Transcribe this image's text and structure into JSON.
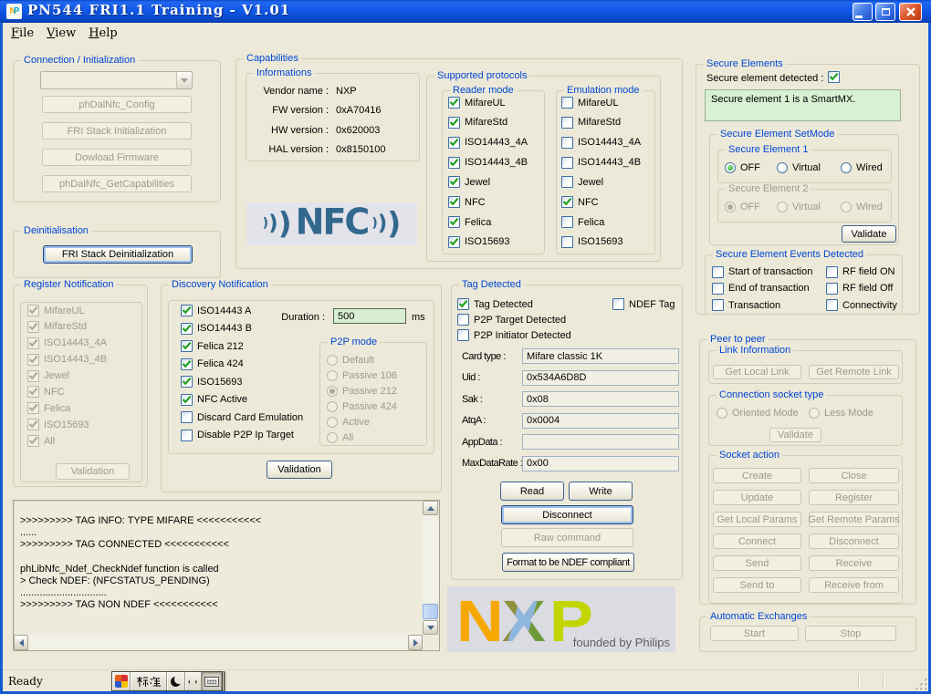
{
  "colors": {
    "titlebar_blue": "#0E5AE6",
    "window_bg": "#ECE9D8",
    "group_label_blue": "#0046D5",
    "duration_field_green": "#D8EFD3",
    "secure_info_green": "#D9F1D3",
    "check_green": "#21A121",
    "nxp_orange": "#F6A800",
    "nxp_blue": "#8FB6DC",
    "nxp_green": "#C3D500",
    "nfc_logo_blue": "#33688E"
  },
  "window": {
    "title": "PN544 FRI1.1 Training - V1.01",
    "icon_letters": "NP"
  },
  "menu": {
    "items": [
      "File",
      "View",
      "Help"
    ]
  },
  "connection": {
    "title": "Connection / Initialization",
    "combo_value": "",
    "buttons": [
      "phDalNfc_Config",
      "FRI Stack Initialization",
      "Dowload Firmware",
      "phDalNfc_GetCapabilities"
    ]
  },
  "deinit": {
    "title": "Deinitialisation",
    "button": "FRI Stack Deinitialization"
  },
  "register": {
    "title": "Register Notification",
    "items": [
      {
        "label": "MifareUL",
        "on": true
      },
      {
        "label": "MifareStd",
        "on": true
      },
      {
        "label": "ISO14443_4A",
        "on": true
      },
      {
        "label": "ISO14443_4B",
        "on": true
      },
      {
        "label": "Jewel",
        "on": true
      },
      {
        "label": "NFC",
        "on": true
      },
      {
        "label": "Felica",
        "on": true
      },
      {
        "label": "ISO15693",
        "on": true
      },
      {
        "label": "All",
        "on": true
      }
    ],
    "button": "Validation"
  },
  "discovery": {
    "title": "Discovery Notification",
    "items": [
      {
        "label": "ISO14443 A",
        "on": true
      },
      {
        "label": "ISO14443 B",
        "on": true
      },
      {
        "label": "Felica 212",
        "on": true
      },
      {
        "label": "Felica 424",
        "on": true
      },
      {
        "label": "ISO15693",
        "on": true
      },
      {
        "label": "NFC Active",
        "on": true
      },
      {
        "label": "Discard Card Emulation",
        "on": false
      },
      {
        "label": "Disable P2P Ip Target",
        "on": false
      }
    ],
    "duration_label": "Duration :",
    "duration_value": "500",
    "duration_unit": "ms",
    "p2p": {
      "title": "P2P mode",
      "items": [
        {
          "label": "Default",
          "on": false
        },
        {
          "label": "Passive 106",
          "on": false
        },
        {
          "label": "Passive 212",
          "on": true
        },
        {
          "label": "Passive 424",
          "on": false
        },
        {
          "label": "Active",
          "on": false
        },
        {
          "label": "All",
          "on": false
        }
      ]
    },
    "button": "Validation"
  },
  "capabilities": {
    "title": "Capabilities",
    "informations": {
      "title": "Informations",
      "rows": [
        {
          "label": "Vendor name :",
          "value": "NXP"
        },
        {
          "label": "FW version :",
          "value": "0xA70416"
        },
        {
          "label": "HW version :",
          "value": "0x620003"
        },
        {
          "label": "HAL version :",
          "value": "0x8150100"
        }
      ]
    },
    "nfc_logo_text": "NFC"
  },
  "protocols": {
    "title": "Supported protocols",
    "reader": {
      "title": "Reader mode",
      "items": [
        {
          "label": "MifareUL",
          "on": true
        },
        {
          "label": "MifareStd",
          "on": true
        },
        {
          "label": "ISO14443_4A",
          "on": true
        },
        {
          "label": "ISO14443_4B",
          "on": true
        },
        {
          "label": "Jewel",
          "on": true
        },
        {
          "label": "NFC",
          "on": true
        },
        {
          "label": "Felica",
          "on": true
        },
        {
          "label": "ISO15693",
          "on": true
        }
      ]
    },
    "emulation": {
      "title": "Emulation mode",
      "items": [
        {
          "label": "MifareUL",
          "on": false
        },
        {
          "label": "MifareStd",
          "on": false
        },
        {
          "label": "ISO14443_4A",
          "on": false
        },
        {
          "label": "ISO14443_4B",
          "on": false
        },
        {
          "label": "Jewel",
          "on": false
        },
        {
          "label": "NFC",
          "on": true
        },
        {
          "label": "Felica",
          "on": false
        },
        {
          "label": "ISO15693",
          "on": false
        }
      ]
    }
  },
  "tag": {
    "title": "Tag Detected",
    "checks": [
      {
        "label": "Tag Detected",
        "on": true
      },
      {
        "label": "NDEF Tag",
        "on": false
      },
      {
        "label": "P2P Target Detected",
        "on": false
      },
      {
        "label": "P2P Initiator Detected",
        "on": false
      }
    ],
    "fields": [
      {
        "label": "Card type :",
        "value": "Mifare classic 1K"
      },
      {
        "label": "Uid :",
        "value": "0x534A6D8D"
      },
      {
        "label": "Sak :",
        "value": "0x08"
      },
      {
        "label": "AtqA :",
        "value": "0x0004"
      },
      {
        "label": "AppData :",
        "value": ""
      },
      {
        "label": "MaxDataRate :",
        "value": "0x00"
      }
    ],
    "buttons": {
      "read": "Read",
      "write": "Write",
      "disconnect": "Disconnect",
      "raw": "Raw command",
      "format": "Format to be NDEF compliant"
    }
  },
  "secure": {
    "title": "Secure Elements",
    "detected_label": "Secure element detected :",
    "detected": true,
    "info": "Secure element 1 is a SmartMX.",
    "setmode": {
      "title": "Secure Element SetMode",
      "se1": {
        "title": "Secure Element 1",
        "items": [
          {
            "label": "OFF",
            "on": true
          },
          {
            "label": "Virtual",
            "on": false
          },
          {
            "label": "Wired",
            "on": false
          }
        ]
      },
      "se2": {
        "title": "Secure Element 2",
        "items": [
          {
            "label": "OFF",
            "on": true
          },
          {
            "label": "Virtual",
            "on": false
          },
          {
            "label": "Wired",
            "on": false
          }
        ]
      },
      "button": "Validate"
    },
    "events": {
      "title": "Secure Element Events Detected",
      "items": [
        {
          "label": "Start of transaction",
          "on": false
        },
        {
          "label": "RF field ON",
          "on": false
        },
        {
          "label": "End of transaction",
          "on": false
        },
        {
          "label": "RF field Off",
          "on": false
        },
        {
          "label": "Transaction",
          "on": false
        },
        {
          "label": "Connectivity",
          "on": false
        }
      ]
    }
  },
  "p2p": {
    "title": "Peer to peer",
    "link": {
      "title": "Link Information",
      "buttons": [
        "Get Local Link",
        "Get Remote Link"
      ]
    },
    "socket_type": {
      "title": "Connection socket type",
      "items": [
        {
          "label": "Oriented Mode",
          "on": false
        },
        {
          "label": "Less Mode",
          "on": false
        }
      ],
      "button": "Validate"
    },
    "socket_action": {
      "title": "Socket action",
      "buttons": [
        "Create",
        "Close",
        "Update",
        "Register",
        "Get Local Params",
        "Get Remote Params",
        "Connect",
        "Disconnect",
        "Send",
        "Receive",
        "Send to",
        "Receive from"
      ]
    }
  },
  "auto": {
    "title": "Automatic Exchanges",
    "buttons": [
      "Start",
      "Stop"
    ]
  },
  "log": {
    "lines": [
      ">>>>>>>>> TAG INFO: TYPE MIFARE <<<<<<<<<<<",
      "......",
      ">>>>>>>>> TAG CONNECTED <<<<<<<<<<<",
      "",
      "phLibNfc_Ndef_CheckNdef function is called",
      "> Check NDEF: (NFCSTATUS_PENDING)",
      "...............................",
      ">>>>>>>>> TAG NON NDEF <<<<<<<<<<<"
    ]
  },
  "nxp": {
    "letters": "NXP",
    "caption": "founded by Philips"
  },
  "status": {
    "ready": "Ready",
    "ime_label": "标准"
  }
}
